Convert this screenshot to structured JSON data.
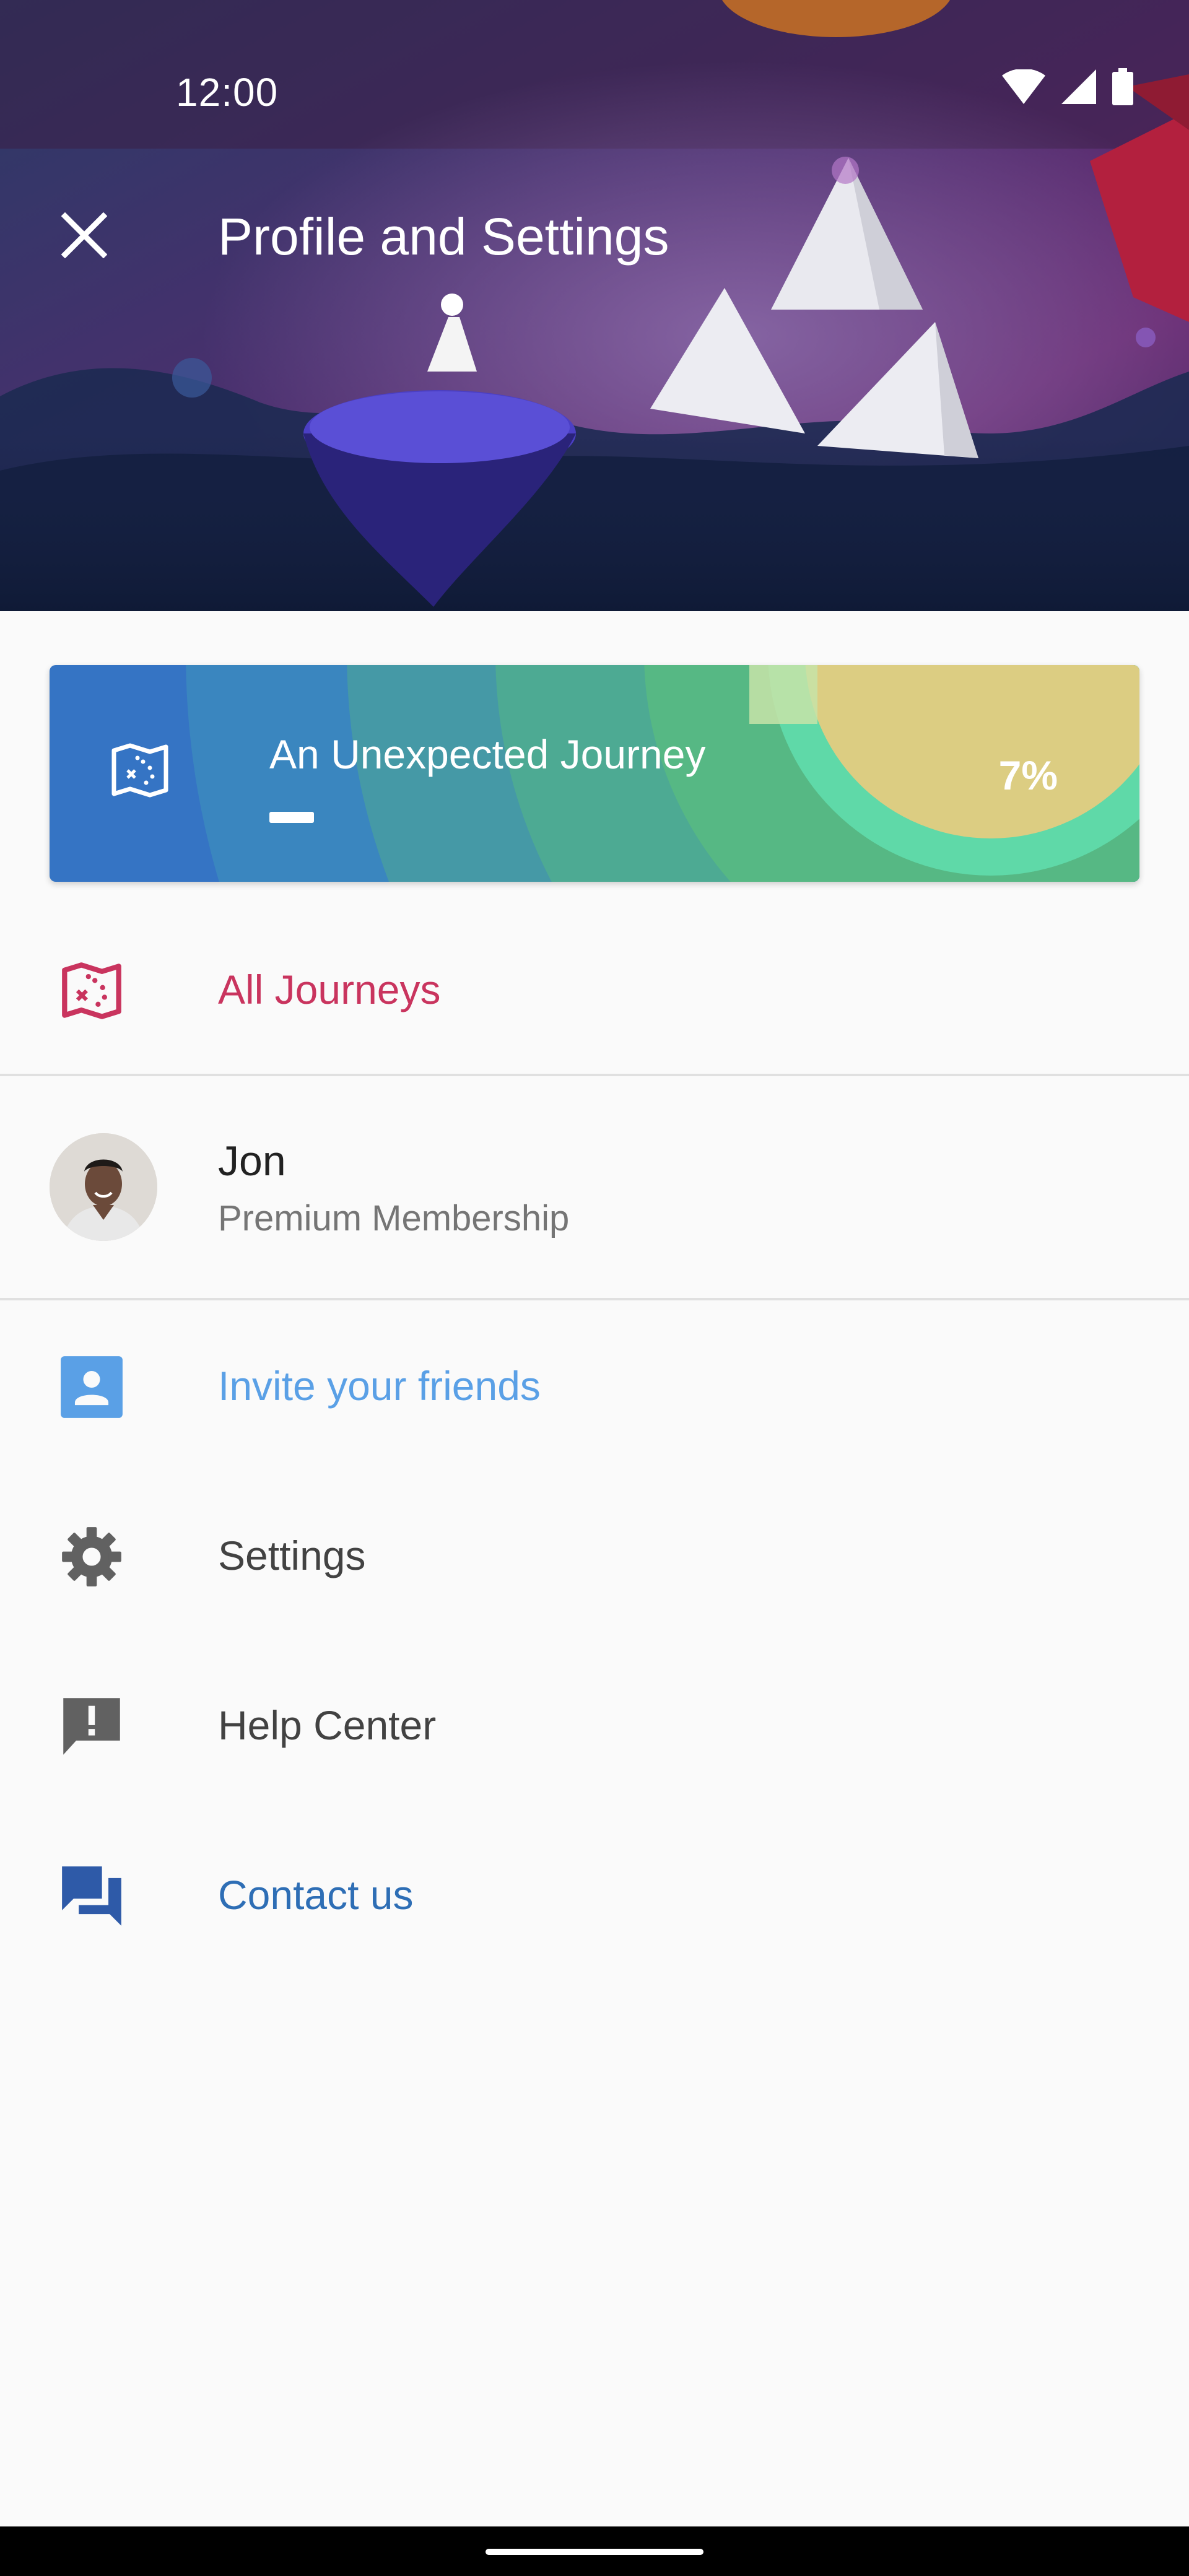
{
  "status_bar": {
    "time": "12:00",
    "icons": [
      "wifi-icon",
      "cellular-signal-icon",
      "battery-icon"
    ]
  },
  "header": {
    "title": "Profile and Settings",
    "close_icon": "close-icon"
  },
  "journey_card": {
    "title": "An Unexpected Journey",
    "progress_percent_label": "7%",
    "progress_value": 0.07,
    "icon": "map-icon"
  },
  "menu": {
    "all_journeys": {
      "label": "All Journeys",
      "icon": "map-icon",
      "color": "#c9345e"
    },
    "profile": {
      "name": "Jon",
      "membership": "Premium Membership"
    },
    "invite": {
      "label": "Invite your friends",
      "icon": "contact-card-icon",
      "color": "#5aa0e6"
    },
    "settings": {
      "label": "Settings",
      "icon": "gear-icon",
      "color": "#424242"
    },
    "help": {
      "label": "Help Center",
      "icon": "feedback-icon",
      "color": "#424242"
    },
    "contact": {
      "label": "Contact us",
      "icon": "chat-icon",
      "color": "#2e6eb5"
    }
  }
}
